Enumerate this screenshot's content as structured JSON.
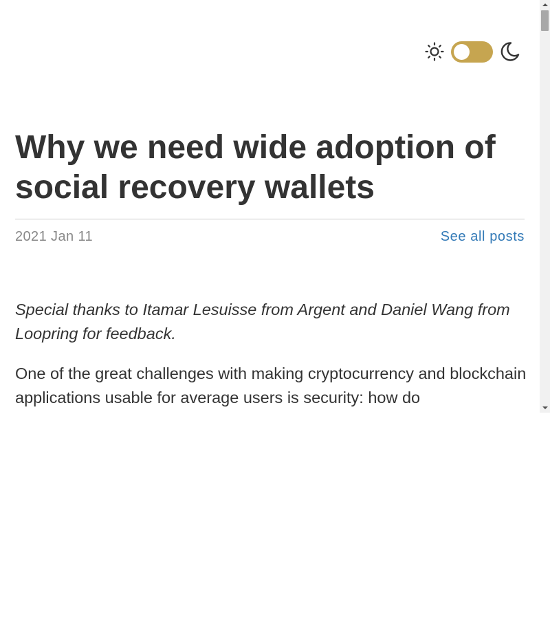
{
  "theme_toggle": {
    "sun_icon": "sun-icon",
    "moon_icon": "moon-icon",
    "toggle_color": "#c6a550"
  },
  "post": {
    "title": "Why we need wide adoption of social recovery wallets",
    "date": "2021 Jan 11",
    "see_all_label": "See all posts",
    "thanks": "Special thanks to Itamar Lesuisse from Argent and Daniel Wang from Loopring for feedback.",
    "intro": "One of the great challenges with making cryptocurrency and blockchain applications usable for average users is security: how do"
  },
  "colors": {
    "title": "#333333",
    "date": "#888888",
    "link": "#337ab7"
  }
}
